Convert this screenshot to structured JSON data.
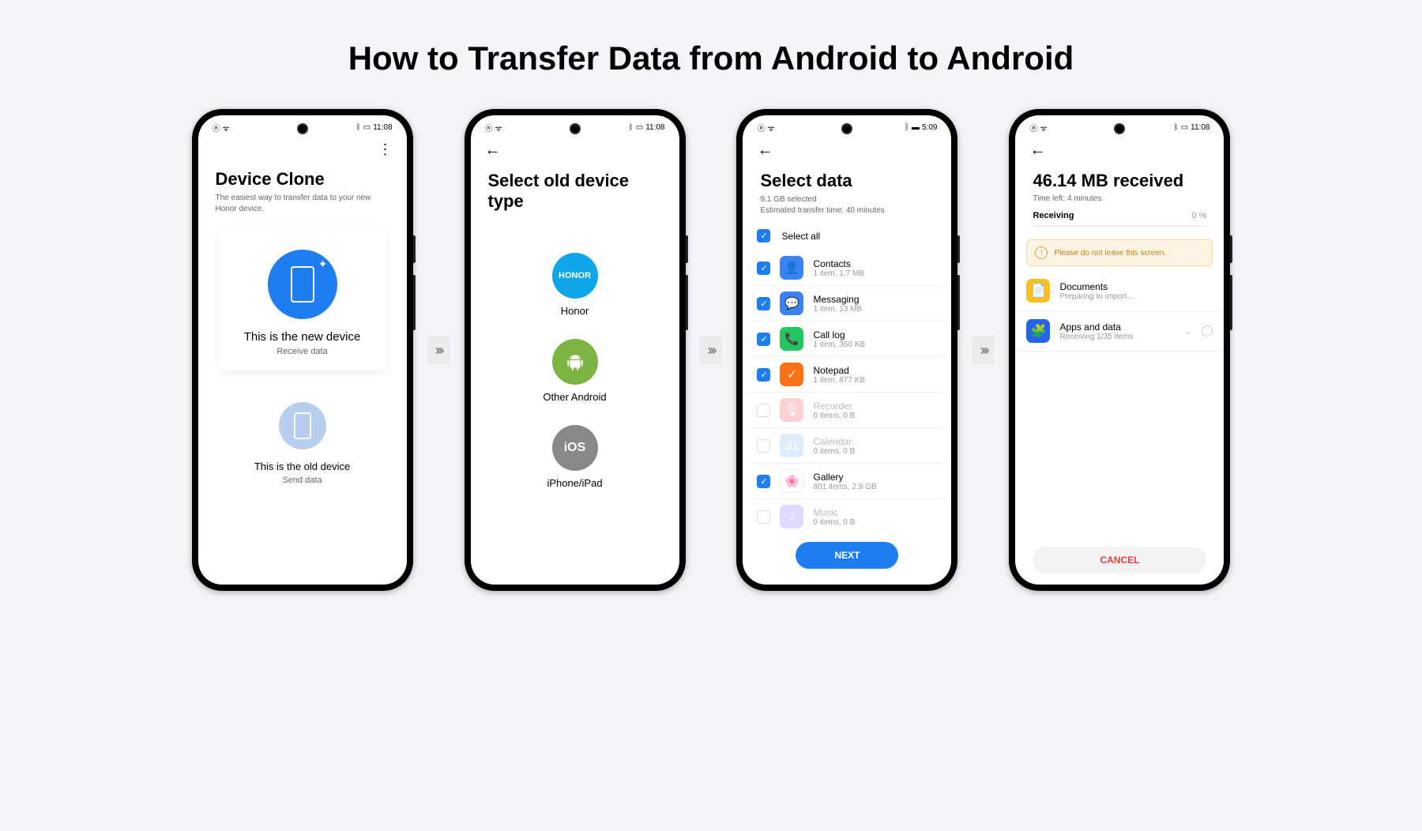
{
  "title": "How to Transfer Data from Android to Android",
  "arrow": "›››",
  "screen1": {
    "status_time": "11:08",
    "title": "Device Clone",
    "subtitle": "The easiest way to transfer data to your new Honor device.",
    "card_new_label": "This is the new device",
    "card_new_sub": "Receive data",
    "card_old_label": "This is the old device",
    "card_old_sub": "Send data"
  },
  "screen2": {
    "status_time": "11:08",
    "title": "Select old device type",
    "options": [
      {
        "label": "Honor",
        "text": "HONOR"
      },
      {
        "label": "Other Android",
        "text": "●"
      },
      {
        "label": "iPhone/iPad",
        "text": "iOS"
      }
    ]
  },
  "screen3": {
    "status_time": "5:09",
    "title": "Select data",
    "sub1": "9.1 GB selected",
    "sub2": "Estimated transfer time: 40 minutes",
    "select_all": "Select all",
    "next": "NEXT",
    "items": [
      {
        "checked": true,
        "name": "Contacts",
        "meta": "1 item, 1.7 MB",
        "color": "#3b82f6",
        "icon": "👤"
      },
      {
        "checked": true,
        "name": "Messaging",
        "meta": "1 item, 13 MB",
        "color": "#3b82f6",
        "icon": "💬"
      },
      {
        "checked": true,
        "name": "Call log",
        "meta": "1 item, 360 KB",
        "color": "#22c55e",
        "icon": "📞"
      },
      {
        "checked": true,
        "name": "Notepad",
        "meta": "1 item, 877 KB",
        "color": "#f97316",
        "icon": "✓"
      },
      {
        "checked": false,
        "name": "Recorder",
        "meta": "0 items, 0 B",
        "color": "#fca5a5",
        "icon": "🎙"
      },
      {
        "checked": false,
        "name": "Calendar",
        "meta": "0 items, 0 B",
        "color": "#bfdbfe",
        "icon": "31"
      },
      {
        "checked": true,
        "name": "Gallery",
        "meta": "801 items, 2.9 GB",
        "color": "#fff",
        "icon": "🌸"
      },
      {
        "checked": false,
        "name": "Music",
        "meta": "0 items, 0 B",
        "color": "#c4b5fd",
        "icon": "♪"
      }
    ]
  },
  "screen4": {
    "status_time": "11:08",
    "title": "46.14 MB received",
    "time_left": "Time left: 4 minutes",
    "receiving_label": "Receiving",
    "percent": "0 %",
    "warning": "Please do not leave this screen.",
    "items": [
      {
        "name": "Documents",
        "meta": "Preparing to import...",
        "color": "#fbbf24",
        "icon": "📄"
      },
      {
        "name": "Apps and data",
        "meta": "Receiving 1/35 items",
        "color": "#2563eb",
        "icon": "🧩"
      }
    ],
    "cancel": "CANCEL"
  }
}
